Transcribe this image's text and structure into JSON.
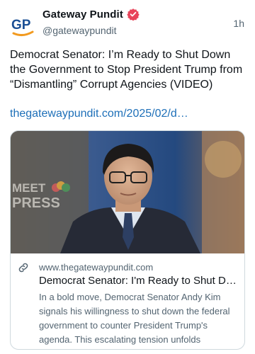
{
  "post": {
    "author_name": "Gateway Pundit",
    "handle": "@gatewaypundit",
    "time": "1h",
    "text": "Democrat Senator: I’m Ready to Shut Down the Government to Stop President Trump from “Dismantling” Corrupt Agencies (VIDEO)",
    "link_text": "thegatewaypundit.com/2025/02/d…",
    "avatar_text": "GP",
    "verified": true
  },
  "card": {
    "domain": "www.thegatewaypundit.com",
    "title": "Democrat Senator: I'm Ready to Shut Down the Government to Stop President Trump",
    "description": "In a bold move, Democrat Senator Andy Kim signals his willingness to shut down the federal government to counter President Trump's agenda. This escalating tension unfolds",
    "image_caption": "MEET THE PRESS"
  },
  "icons": {
    "verified": "verified-badge-icon",
    "link": "link-icon"
  },
  "colors": {
    "accent": "#1d6fb8",
    "verified": "#e8445a",
    "logo_blue": "#1a4f94",
    "logo_orange": "#f29a1f",
    "text_primary": "#0f1419",
    "text_secondary": "#536471"
  }
}
